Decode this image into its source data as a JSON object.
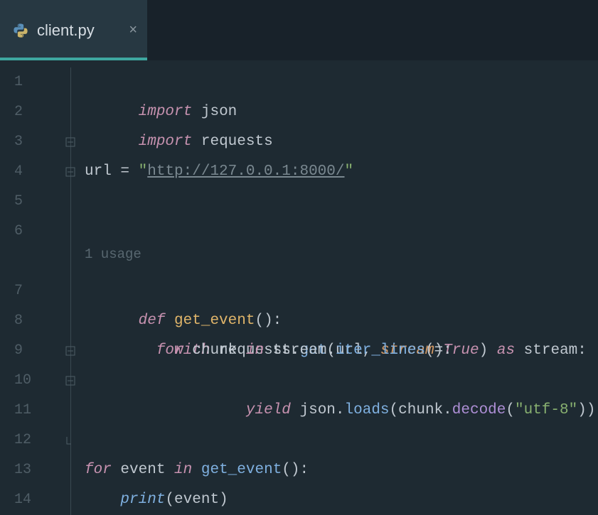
{
  "tab": {
    "filename": "client.py",
    "close_glyph": "×"
  },
  "gutter": [
    "1",
    "2",
    "3",
    "4",
    "5",
    "6",
    "",
    "7",
    "8",
    "9",
    "10",
    "11",
    "12",
    "13",
    "14"
  ],
  "hints": {
    "usage": "1 usage"
  },
  "code": {
    "l1": {
      "import": "import",
      "mod": "json"
    },
    "l2": {
      "import": "import",
      "mod": "requests"
    },
    "l4": {
      "var": "url",
      "eq": " = ",
      "q1": "\"",
      "url": "http://127.0.0.1:8000/",
      "q2": "\""
    },
    "l7": {
      "def": "def",
      "fn": "get_event",
      "parens": "():"
    },
    "l8": {
      "with": "with",
      "obj": "requests",
      "dot1": ".",
      "get": "get",
      "open": "(",
      "arg1": "url",
      "comma": ", ",
      "kw": "stream",
      "eq": "=",
      "true": "True",
      "close": ")",
      "as": "as",
      "var": "stream",
      "colon": ":"
    },
    "l9": {
      "for": "for",
      "v": "chunk",
      "in": "in",
      "obj": "stream",
      "dot": ".",
      "m": "iter_lines",
      "p": "():"
    },
    "l10": {
      "yield": "yield",
      "obj": "json",
      "dot1": ".",
      "m1": "loads",
      "open1": "(",
      "arg": "chunk",
      "dot2": ".",
      "m2": "decode",
      "open2": "(",
      "str": "\"utf-8\"",
      "close": "))"
    },
    "l13": {
      "for": "for",
      "v": "event",
      "in": "in",
      "fn": "get_event",
      "p": "():"
    },
    "l14": {
      "print": "print",
      "open": "(",
      "arg": "event",
      "close": ")"
    }
  }
}
